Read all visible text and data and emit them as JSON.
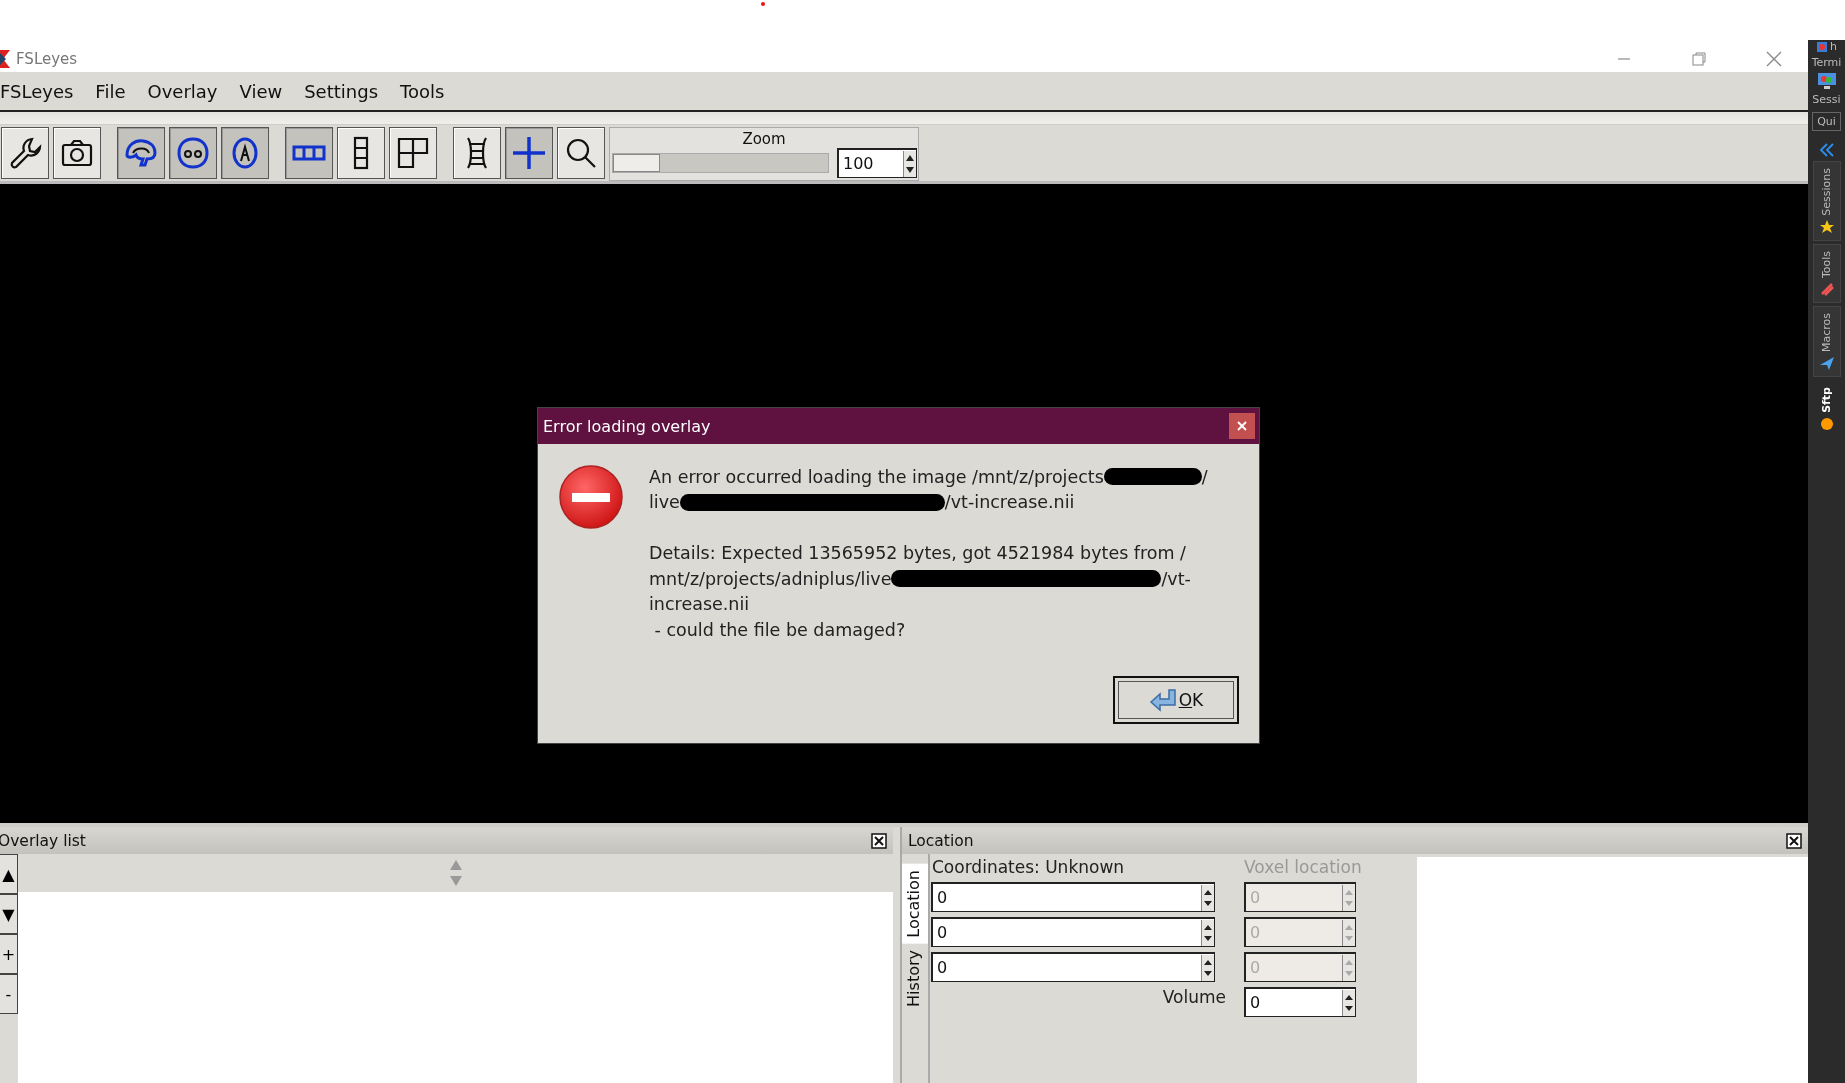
{
  "window": {
    "title": "FSLeyes"
  },
  "menu": [
    "FSLeyes",
    "File",
    "Overlay",
    "View",
    "Settings",
    "Tools"
  ],
  "toolbar": {
    "groups": [
      [
        {
          "selected": false
        },
        {
          "selected": false
        }
      ],
      [
        {
          "selected": true
        },
        {
          "selected": true
        },
        {
          "selected": true
        }
      ],
      [
        {
          "selected": true
        },
        {
          "selected": false
        },
        {
          "selected": false
        }
      ],
      [
        {
          "selected": false
        },
        {
          "selected": true
        },
        {
          "selected": false
        }
      ]
    ],
    "zoom": {
      "label": "Zoom",
      "level": 0,
      "value": "100"
    }
  },
  "dialog": {
    "title": "Error loading overlay",
    "paragraphs": [
      [
        [
          {
            "kind": "text",
            "text": "An error occurred loading the image /mnt/z/projects"
          },
          {
            "kind": "redaction"
          },
          {
            "kind": "text",
            "text": "/"
          }
        ],
        [
          {
            "kind": "text",
            "text": "live"
          },
          {
            "kind": "redaction"
          },
          {
            "kind": "text",
            "text": "/vt-increase.nii"
          }
        ]
      ],
      [
        [
          {
            "kind": "text",
            "text": "Details: Expected 13565952 bytes, got 4521984 bytes from /"
          }
        ],
        [
          {
            "kind": "text",
            "text": "mnt/z/projects/adniplus/live"
          },
          {
            "kind": "redaction"
          },
          {
            "kind": "text",
            "text": "/vt-"
          }
        ],
        [
          {
            "kind": "text",
            "text": "increase.nii"
          }
        ],
        [
          {
            "kind": "text",
            "text": " - could the file be damaged?"
          }
        ]
      ]
    ],
    "button": "OK"
  },
  "overlay_list": {
    "title": "Overlay list",
    "buttons": [
      "▲",
      "▼",
      "+",
      "-"
    ]
  },
  "location": {
    "title": "Location",
    "tabs": [
      {
        "label": "Location",
        "selected": true
      },
      {
        "label": "History",
        "selected": false
      }
    ],
    "coordinates_label": "Coordinates: Unknown",
    "world": [
      "0",
      "0",
      "0"
    ],
    "voxel_label": "Voxel location",
    "voxel": [
      "0",
      "0",
      "0"
    ],
    "voxel_disabled": true,
    "volume_label": "Volume",
    "volume": "0"
  },
  "side_panel": {
    "header": [
      "h",
      "Termi",
      "Sessi"
    ],
    "quick": "Qui",
    "tabs": [
      {
        "label": "Sessions",
        "selected": false
      },
      {
        "label": "Tools",
        "selected": false
      },
      {
        "label": "Macros",
        "selected": false
      },
      {
        "label": "Sftp",
        "selected": true
      }
    ]
  }
}
